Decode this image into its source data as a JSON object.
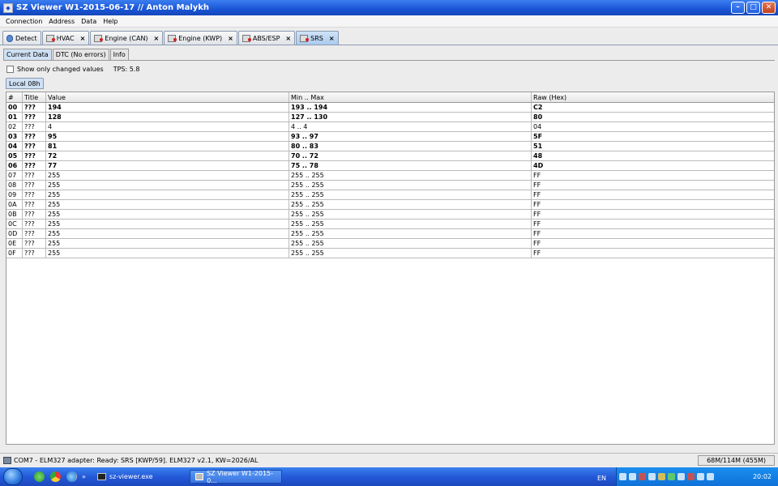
{
  "window": {
    "title": "SZ Viewer W1-2015-06-17 // Anton Malykh",
    "controls": {
      "minimize": "–",
      "maximize": "□",
      "close": "✕"
    }
  },
  "menu": [
    "Connection",
    "Address",
    "Data",
    "Help"
  ],
  "main_tabs": [
    {
      "label": "Detect",
      "icon": "detect-icon",
      "closable": false
    },
    {
      "label": "HVAC",
      "icon": "module-icon",
      "closable": true
    },
    {
      "label": "Engine (CAN)",
      "icon": "module-icon",
      "closable": true
    },
    {
      "label": "Engine (KWP)",
      "icon": "module-icon",
      "closable": true
    },
    {
      "label": "ABS/ESP",
      "icon": "module-icon",
      "closable": true
    },
    {
      "label": "SRS",
      "icon": "module-icon",
      "closable": true,
      "active": true
    }
  ],
  "close_glyph": "×",
  "sub_tabs": [
    {
      "label": "Current Data",
      "active": true
    },
    {
      "label": "DTC (No errors)"
    },
    {
      "label": "Info"
    }
  ],
  "options": {
    "show_changed_label": "Show only changed values",
    "show_changed_checked": false,
    "tps_label": "TPS: 5.8"
  },
  "local_tab": "Local 08h",
  "table": {
    "headers": [
      "#",
      "Title",
      "Value",
      "Min .. Max",
      "Raw (Hex)"
    ],
    "rows": [
      {
        "id": "00",
        "title": "???",
        "value": "194",
        "minmax": "193 .. 194",
        "raw": "C2",
        "bold": true
      },
      {
        "id": "01",
        "title": "???",
        "value": "128",
        "minmax": "127 .. 130",
        "raw": "80",
        "bold": true
      },
      {
        "id": "02",
        "title": "???",
        "value": "4",
        "minmax": "4 .. 4",
        "raw": "04",
        "bold": false
      },
      {
        "id": "03",
        "title": "???",
        "value": "95",
        "minmax": "93 .. 97",
        "raw": "5F",
        "bold": true
      },
      {
        "id": "04",
        "title": "???",
        "value": "81",
        "minmax": "80 .. 83",
        "raw": "51",
        "bold": true
      },
      {
        "id": "05",
        "title": "???",
        "value": "72",
        "minmax": "70 .. 72",
        "raw": "48",
        "bold": true
      },
      {
        "id": "06",
        "title": "???",
        "value": "77",
        "minmax": "75 .. 78",
        "raw": "4D",
        "bold": true
      },
      {
        "id": "07",
        "title": "???",
        "value": "255",
        "minmax": "255 .. 255",
        "raw": "FF",
        "bold": false
      },
      {
        "id": "08",
        "title": "???",
        "value": "255",
        "minmax": "255 .. 255",
        "raw": "FF",
        "bold": false
      },
      {
        "id": "09",
        "title": "???",
        "value": "255",
        "minmax": "255 .. 255",
        "raw": "FF",
        "bold": false
      },
      {
        "id": "0A",
        "title": "???",
        "value": "255",
        "minmax": "255 .. 255",
        "raw": "FF",
        "bold": false
      },
      {
        "id": "0B",
        "title": "???",
        "value": "255",
        "minmax": "255 .. 255",
        "raw": "FF",
        "bold": false
      },
      {
        "id": "0C",
        "title": "???",
        "value": "255",
        "minmax": "255 .. 255",
        "raw": "FF",
        "bold": false
      },
      {
        "id": "0D",
        "title": "???",
        "value": "255",
        "minmax": "255 .. 255",
        "raw": "FF",
        "bold": false
      },
      {
        "id": "0E",
        "title": "???",
        "value": "255",
        "minmax": "255 .. 255",
        "raw": "FF",
        "bold": false
      },
      {
        "id": "0F",
        "title": "???",
        "value": "255",
        "minmax": "255 .. 255",
        "raw": "FF",
        "bold": false
      }
    ]
  },
  "status": {
    "text": "COM7 - ELM327 adapter: Ready: SRS [KWP/59]. ELM327 v2.1, KW=2026/AL",
    "memory": "68M/114M (455M)"
  },
  "taskbar": {
    "more_glyph": "»",
    "tasks": [
      {
        "label": "sz-viewer.exe",
        "icon": "console-icon",
        "active": false
      },
      {
        "label": "SZ Viewer W1-2015-0...",
        "icon": "sz-viewer-icon",
        "active": true
      }
    ],
    "language": "EN",
    "time": "20:02"
  }
}
